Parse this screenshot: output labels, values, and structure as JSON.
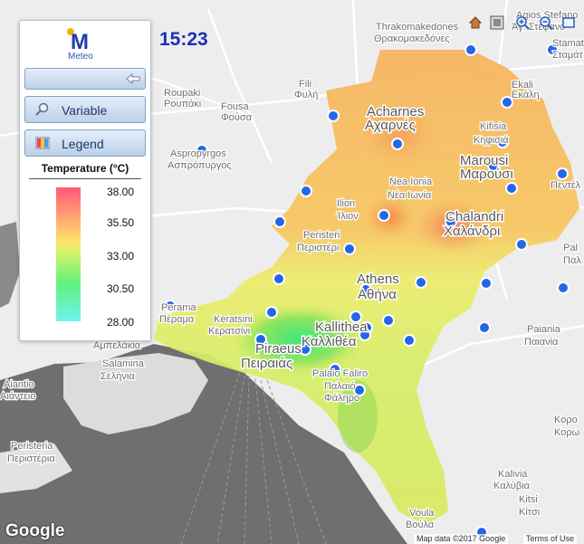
{
  "clock": {
    "time": "15:23"
  },
  "panel": {
    "logo_text": "Meteo",
    "variable_label": "Variable",
    "legend_label": "Legend",
    "legend_title": "Temperature (°C)",
    "legend_ticks": [
      "38.00",
      "35.50",
      "33.00",
      "30.50",
      "28.00"
    ],
    "legend_colors": [
      "#ff5a7a",
      "#ffe06a",
      "#d8f26a",
      "#5ff27c",
      "#70f3f2"
    ]
  },
  "map": {
    "attribution": "Map data ©2017 Google",
    "terms": "Terms of Use",
    "google_logo": "Google",
    "labels": {
      "agios_stefanos": "Agios Stefano",
      "agios_stefanos_gr": "Άγ. Στεφανο",
      "thrakomakedones": "Thrakomakedones",
      "thrakomakedones_gr": "Θρακομακεδόνες",
      "stamata": "Stamat",
      "stamata_gr": "Σταμάτ",
      "ekali": "Ekali",
      "ekali_gr": "Εκάλη",
      "fili": "Fili",
      "fili_gr": "Φυλή",
      "roupaki": "Roupaki",
      "roupaki_gr": "Ρουπάκι",
      "fousa": "Fousa",
      "fousa_gr": "Φούσα",
      "acharnes": "Acharnes",
      "acharnes_gr": "Αχαρνές",
      "kifisia": "Kifisia",
      "kifisia_gr": "Κηφισιά",
      "aspropyrgos": "Aspropyrgos",
      "aspropyrgos_gr": "Ασπρόπυργος",
      "marousi": "Marousi",
      "marousi_gr": "Μαρούσι",
      "penteli": "Πεντέλ",
      "nea_ionia": "Nea Ionia",
      "nea_ionia_gr": "Νέα Ιωνία",
      "ilion": "Ilion",
      "ilion_gr": "Ίλιον",
      "chalandri": "Chalandri",
      "chalandri_gr": "Χαλάνδρι",
      "peristeri": "Peristeri",
      "peristeri_gr": "Περιστέρι",
      "pal": "Pal",
      "pal_gr": "Παλ",
      "athens": "Athens",
      "athens_gr": "Αθήνα",
      "perama": "Perama",
      "perama_gr": "Πέραμα",
      "keratsini": "Keratsini",
      "keratsini_gr": "Κερατσίνι",
      "ampelakia": "Αμπελάκια",
      "kallithea": "Kallithea",
      "kallithea_gr": "Καλλιθέα",
      "paiania": "Paiania",
      "paiania_gr": "Παιανία",
      "salamina": "Salamina",
      "salamina_gr": "Σελήνια",
      "piraeus": "Piraeus",
      "piraeus_gr": "Πειραιάς",
      "aiantio": "Aiantio",
      "aiantio_gr": "Αιάντειο",
      "palaio_faliro": "Palaio Faliro",
      "palaio_faliro_gr1": "Παλαιό",
      "palaio_faliro_gr2": "Φάληρο",
      "koropi": "Κορο",
      "koropi_gr": "Κορω",
      "peristeria": "Peristeria",
      "peristeria_gr": "Περιστέρια",
      "kalivia": "Kalivia",
      "kalivia_gr": "Καλύβια",
      "kitsi": "Kitsi",
      "kitsi_gr": "Κίτσι",
      "voula": "Voula",
      "voula_gr": "Βούλα"
    }
  }
}
